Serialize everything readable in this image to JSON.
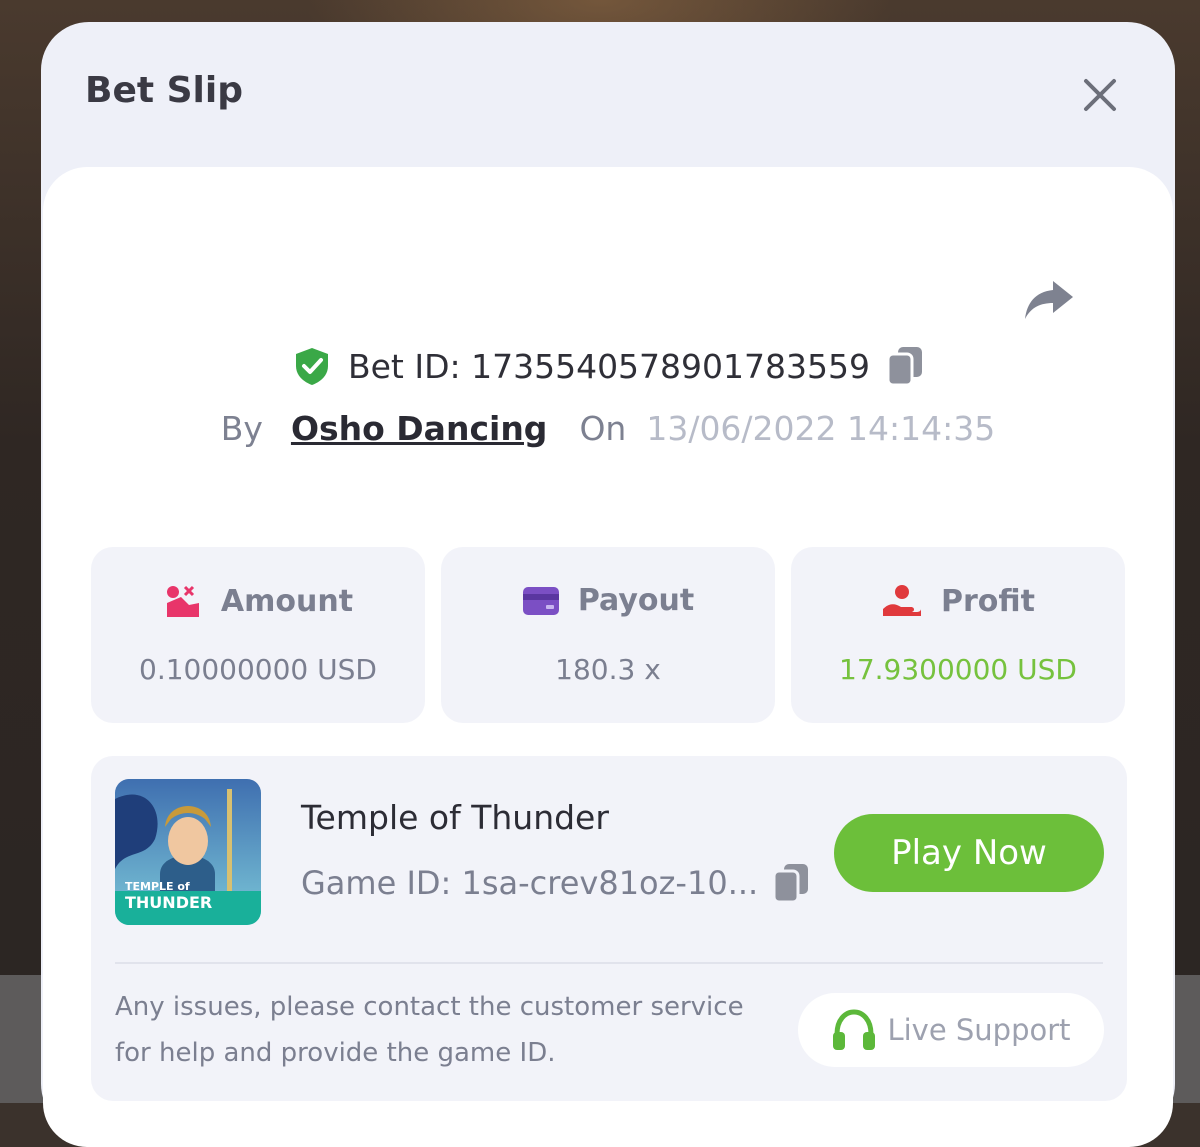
{
  "modal": {
    "title": "Bet Slip"
  },
  "bet": {
    "id_label": "Bet ID: 1735540578901783559",
    "by_label": "By",
    "user": "Osho Dancing",
    "on_label": "On",
    "date": "13/06/2022 14:14:35"
  },
  "stats": [
    {
      "label": "Amount",
      "value": "0.10000000 USD",
      "icon": "amount-icon",
      "color": "#e8356a"
    },
    {
      "label": "Payout",
      "value": "180.3 x",
      "icon": "card-icon",
      "color": "#7b4fc4"
    },
    {
      "label": "Profit",
      "value": "17.9300000 USD",
      "icon": "profit-hand-icon",
      "color": "#e0393d"
    }
  ],
  "game": {
    "name": "Temple of Thunder",
    "id_label": "Game ID: 1sa-crev81oz-10...",
    "thumb_line1": "TEMPLE of",
    "thumb_line2": "THUNDER",
    "play_label": "Play Now"
  },
  "support": {
    "text": "Any issues, please contact the customer service for help and provide the game ID.",
    "button_label": "Live Support"
  },
  "colors": {
    "accent_green": "#6cbf3a",
    "profit_green": "#76c23e",
    "shield_green": "#3aa847"
  }
}
